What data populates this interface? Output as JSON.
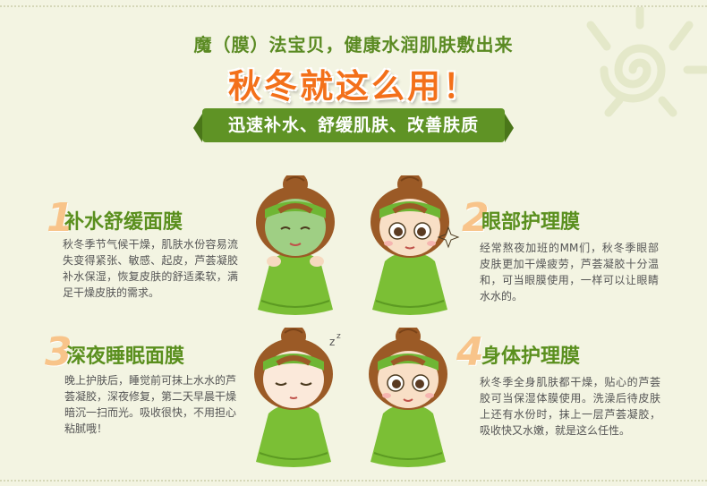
{
  "header": {
    "headline": "魔（膜）法宝贝，健康水润肌肤敷出来",
    "title": "秋冬就这么用！",
    "ribbon": "迅速补水、舒缓肌肤、改善肤质"
  },
  "colors": {
    "background": "#f3f4e2",
    "green": "#5f9325",
    "orange": "#f3701a",
    "number": "#f8c48a"
  },
  "sections": [
    {
      "number": "1",
      "title": "补水舒缓面膜",
      "body": "秋冬季节气候干燥，肌肤水份容易流失变得紧张、敏感、起皮，芦荟凝胶补水保湿，恢复皮肤的舒适柔软，满足干燥皮肤的需求。"
    },
    {
      "number": "2",
      "title": "眼部护理膜",
      "body": "经常熬夜加班的MM们，秋冬季眼部皮肤更加干燥疲劳，芦荟凝胶十分温和，可当眼膜使用，一样可以让眼睛水水的。"
    },
    {
      "number": "3",
      "title": "深夜睡眠面膜",
      "body": "晚上护肤后，睡觉前可抹上水水的芦荟凝胶，深夜修复，第二天早晨干燥暗沉一扫而光。吸收很快，不用担心粘腻哦！"
    },
    {
      "number": "4",
      "title": "身体护理膜",
      "body": "秋冬季全身肌肤都干燥，贴心的芦荟胶可当保湿体膜使用。洗澡后待皮肤上还有水份时，抹上一层芦荟凝胶，吸收快又水嫩，就是这么任性。"
    }
  ],
  "illustrations": [
    {
      "icon": "girl-face-mask-icon"
    },
    {
      "icon": "girl-eye-mask-icon"
    },
    {
      "icon": "girl-sleeping-icon"
    },
    {
      "icon": "girl-body-care-icon"
    }
  ]
}
